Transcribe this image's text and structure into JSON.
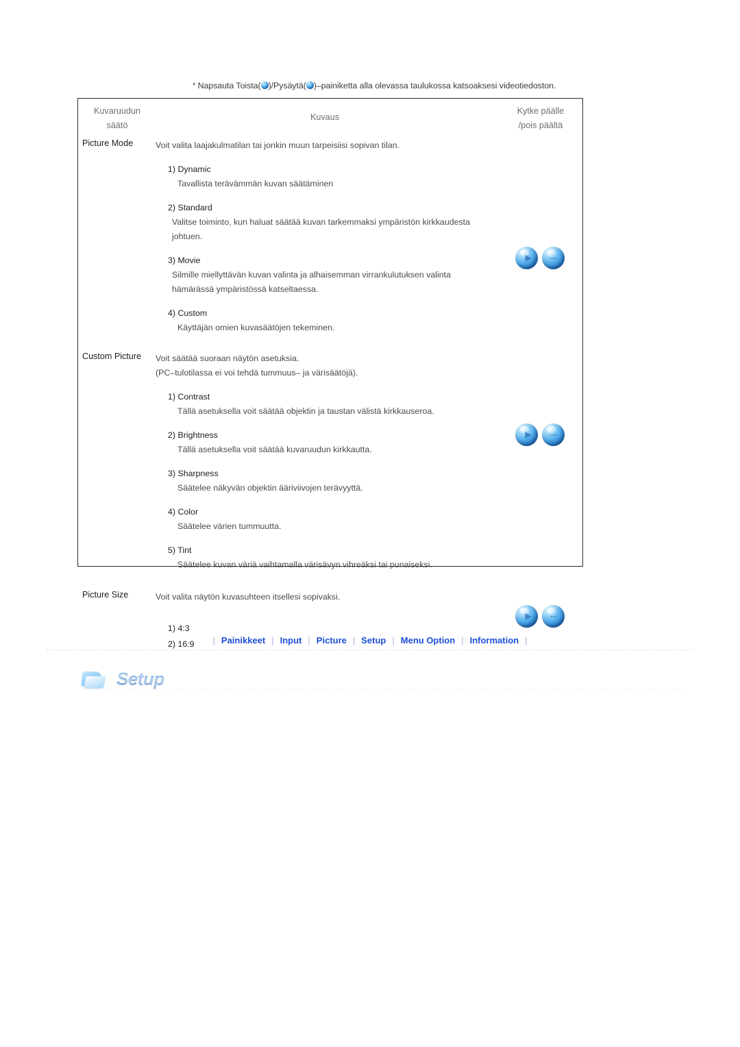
{
  "note": {
    "prefix": "*",
    "part1": " Napsauta Toista(",
    "part2": ")/Pysäytä(",
    "part3": ")–painiketta alla olevassa taulukossa katsoaksesi videotiedoston.",
    "play_icon": "play-ball-icon",
    "pause_icon": "pause-ball-icon"
  },
  "table": {
    "headers": {
      "col1_line1": "Kuvaruudun",
      "col1_line2": "säätö",
      "col2": "Kuvaus",
      "col3_line1": "Kytke päälle",
      "col3_line2": "/pois päältä"
    },
    "rows": [
      {
        "label": "Picture Mode",
        "lead": "Voit valita laajakulmatilan tai jonkin muun tarpeisiisi sopivan tilan.",
        "items": [
          {
            "head": "1) Dynamic",
            "body": "Tavallista terävämmän kuvan säätäminen"
          },
          {
            "head": "2) Standard",
            "body": "Valitse toiminto, kun haluat säätää kuvan tarkemmaksi ympäristön kirkkaudesta johtuen."
          },
          {
            "head": "3) Movie",
            "body": "Silmille miellyttävän kuvan valinta ja alhaisemman virrankulutuksen valinta hämärässä ympäristössä katseltaessa."
          },
          {
            "head": "4) Custom",
            "body": "Käyttäjän omien kuvasäätöjen tekeminen."
          }
        ]
      },
      {
        "label": "Custom Picture",
        "lead": "Voit säätää suoraan näytön asetuksia.",
        "lead2": "(PC–tulotilassa ei voi tehdä tummuus– ja värisäätöjä).",
        "items": [
          {
            "head": "1) Contrast",
            "body": "Tällä asetuksella voit säätää objektin ja taustan välistä kirkkauseroa."
          },
          {
            "head": "2) Brightness",
            "body": "Tällä asetuksella voit säätää kuvaruudun kirkkautta."
          },
          {
            "head": "3) Sharpness",
            "body": "Säätelee näkyvän objektin ääriviivojen terävyyttä."
          },
          {
            "head": "4) Color",
            "body": "Säätelee värien tummuutta."
          },
          {
            "head": "5) Tint",
            "body": "Säätelee kuvan väriä vaihtamalla värisävyn vihreäksi tai punaiseksi."
          }
        ]
      },
      {
        "label": "Picture Size",
        "lead": "Voit valita näytön kuvasuhteen itsellesi sopivaksi.",
        "plain_items": [
          "1) 4:3",
          "2) 16:9"
        ]
      }
    ]
  },
  "nav": {
    "separator": "|",
    "links": [
      "Painikkeet",
      "Input",
      "Picture",
      "Setup",
      "Menu Option",
      "Information"
    ]
  },
  "section": {
    "title": "Setup",
    "icon": "folder-icon"
  },
  "colors": {
    "nav_link": "#1a4fd6",
    "nav_separator": "#9fb6e8",
    "table_border": "#2d2d2d",
    "header_text": "#6e6e6e",
    "body_text": "#4a4a4a",
    "label_text": "#1d1d1d",
    "ball_blue": "#2c7fd1",
    "folder_blue": "#8fcdf5"
  }
}
